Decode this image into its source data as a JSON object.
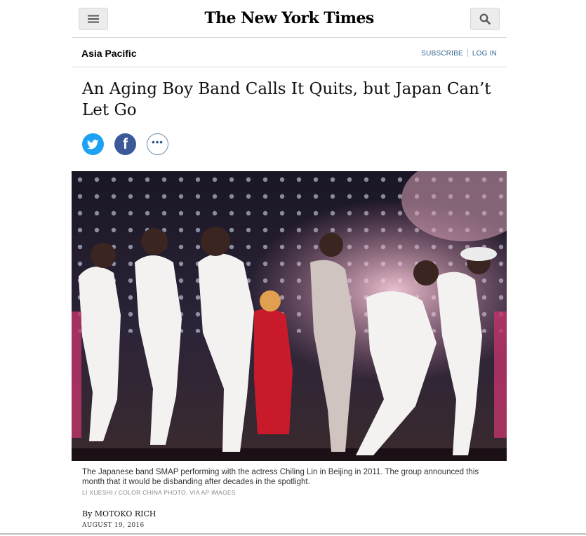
{
  "header": {
    "masthead": "The New York Times",
    "menu_icon": "hamburger-menu-icon",
    "search_icon": "search-icon"
  },
  "section": {
    "name": "Asia Pacific",
    "subscribe": "SUBSCRIBE",
    "login": "LOG IN",
    "link_color": "#326891"
  },
  "article": {
    "headline": "An Aging Boy Band Calls It Quits, but Japan Can’t Let Go",
    "share": {
      "twitter_icon": "twitter-icon",
      "facebook_icon": "facebook-icon",
      "more_icon": "more-options-icon",
      "more_glyph": "•••",
      "twitter_color": "#1da1f2",
      "facebook_color": "#3b5998"
    },
    "caption": "The Japanese band SMAP performing with the actress Chiling Lin in Beijing in 2011. The group announced this month that it would be disbanding after decades in the spotlight.",
    "credit": "LI XUESHI / COLOR CHINA PHOTO, VIA AP IMAGES",
    "byline": "By MOTOKO RICH",
    "date": "AUGUST 19, 2016"
  }
}
